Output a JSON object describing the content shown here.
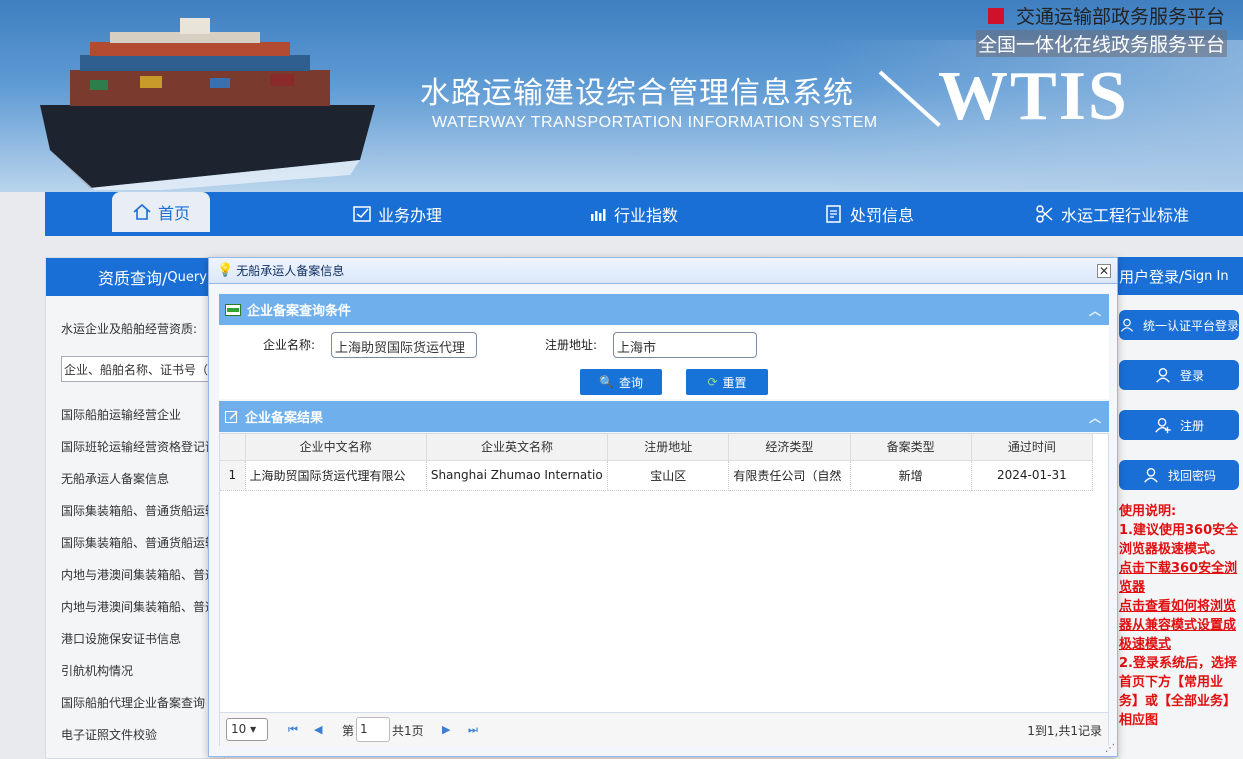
{
  "header": {
    "gov_platform": "交通运输部政务服务平台",
    "gov_national": "全国一体化在线政务服务平台",
    "system_title": "水路运输建设综合管理信息系统",
    "system_subtitle": "WATERWAY TRANSPORTATION INFORMATION SYSTEM",
    "logo": "WTIS"
  },
  "nav": {
    "items": [
      {
        "label": "首页",
        "icon": "home-icon",
        "active": true
      },
      {
        "label": "业务办理",
        "icon": "checklist-icon"
      },
      {
        "label": "行业指数",
        "icon": "bar-chart-icon"
      },
      {
        "label": "处罚信息",
        "icon": "document-icon"
      },
      {
        "label": "水运工程行业标准",
        "icon": "scissors-icon"
      }
    ]
  },
  "left": {
    "header_cn": "资质查询/",
    "header_en": "Query",
    "label": "水运企业及船舶经营资质:",
    "search_placeholder": "企业、船舶名称、证书号（",
    "links": [
      "国际船舶运输经营企业",
      "国际班轮运输经营资格登记证",
      "无船承运人备案信息",
      "国际集装箱船、普通货船运输",
      "国际集装箱船、普通货船运输",
      "内地与港澳间集装箱船、普通",
      "内地与港澳间集装箱船、普通",
      "港口设施保安证书信息",
      "引航机构情况",
      "国际船舶代理企业备案查询",
      "电子证照文件校验"
    ]
  },
  "right": {
    "header_cn": "用户登录/",
    "header_en": "Sign In",
    "buttons": [
      "统一认证平台登录",
      "登录",
      "注册",
      "找回密码"
    ],
    "notes": [
      {
        "text": "使用说明:",
        "u": false
      },
      {
        "text": "1.建议使用360安全浏览器极速模式。",
        "u": false
      },
      {
        "text": "点击下载360安全浏览器",
        "u": true
      },
      {
        "text": "点击查看如何将浏览器从兼容模式设置成极速模式",
        "u": true
      },
      {
        "text": "2.登录系统后，选择首页下方【常用业务】或【全部业务】相应图",
        "u": false
      }
    ]
  },
  "dialog": {
    "title": "无船承运人备案信息",
    "close": "☒",
    "query_section": "企业备案查询条件",
    "company_label": "企业名称:",
    "company_value": "上海助贸国际货运代理",
    "address_label": "注册地址:",
    "address_value": "上海市",
    "search_btn": "查询",
    "reset_btn": "重置",
    "result_section": "企业备案结果",
    "columns": [
      "企业中文名称",
      "企业英文名称",
      "注册地址",
      "经济类型",
      "备案类型",
      "通过时间"
    ],
    "rows": [
      [
        "1",
        "上海助贸国际货运代理有限公",
        "Shanghai Zhumao Internatio",
        "宝山区",
        "有限责任公司（自然",
        "新增",
        "2024-01-31"
      ]
    ],
    "pager": {
      "page_size": "10",
      "page_prefix": "第",
      "page_value": "1",
      "page_total": "共1页",
      "summary": "1到1,共1记录"
    }
  }
}
